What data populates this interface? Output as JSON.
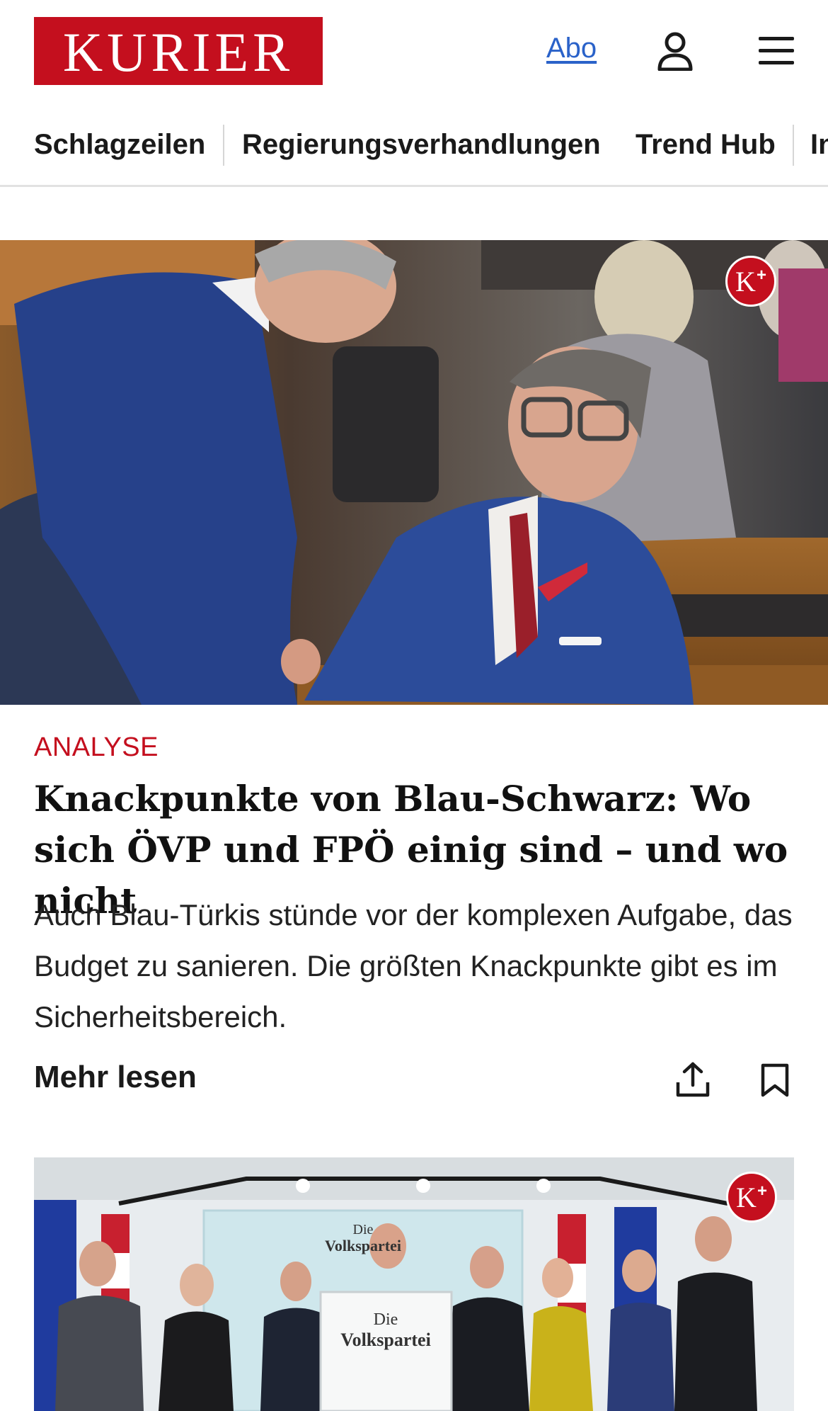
{
  "header": {
    "logo_text": "KURIER",
    "abo_label": "Abo",
    "user_icon": "user-icon",
    "menu_icon": "hamburger-menu-icon"
  },
  "nav": {
    "items": [
      {
        "label": "Schlagzeilen"
      },
      {
        "label": "Regierungsverhandlungen"
      },
      {
        "label": "Trend Hub"
      },
      {
        "label": "In"
      }
    ]
  },
  "article1": {
    "premium_badge": "K+",
    "kicker": "ANALYSE",
    "headline": "Knackpunkte von Blau-Schwarz: Wo sich ÖVP und FPÖ einig sind – und wo nicht",
    "teaser": "Auch Blau-Türkis stünde vor der komplexen Aufgabe, das Budget zu sanieren. Die größten Knackpunkte gibt es im Sicherheitsbereich.",
    "more_label": "Mehr lesen",
    "share_icon": "share-icon",
    "bookmark_icon": "bookmark-icon"
  },
  "article2": {
    "premium_badge": "K+",
    "backdrop_line1": "Die",
    "backdrop_line2": "Volkspartei",
    "lectern_line1": "Die",
    "lectern_line2": "Volkspartei"
  },
  "colors": {
    "brand_red": "#c40f1e",
    "link_blue": "#2a62c9"
  }
}
